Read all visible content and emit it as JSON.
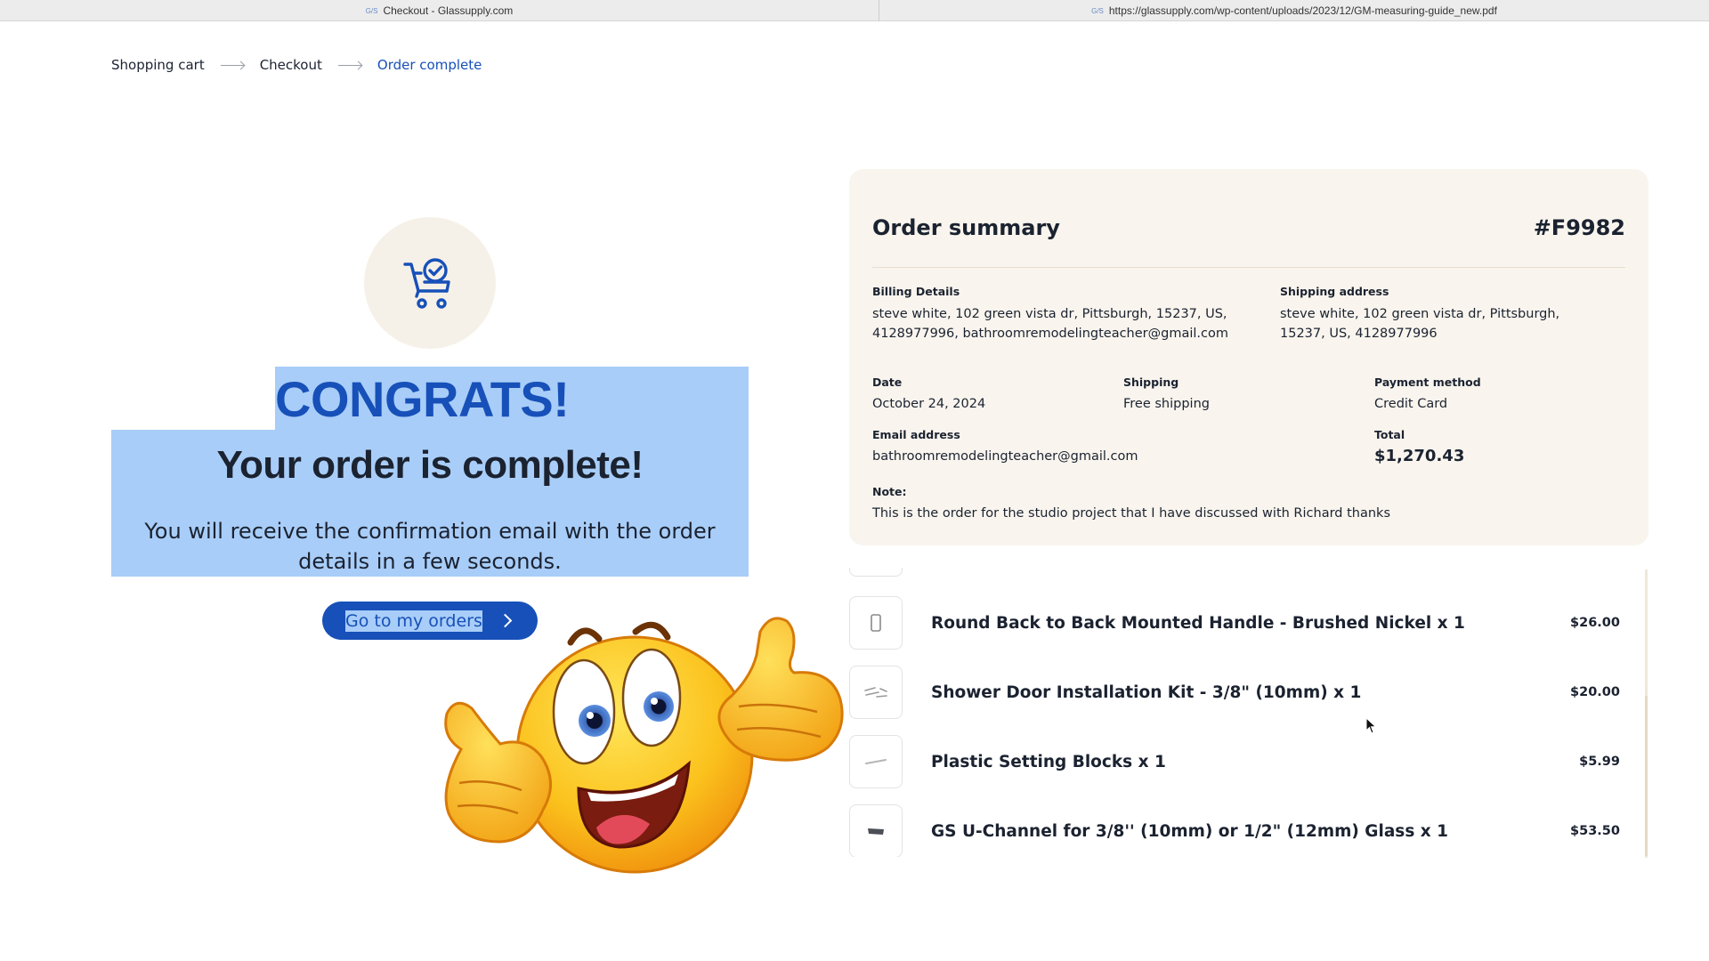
{
  "browser": {
    "tab1_title": "Checkout - Glassupply.com",
    "tab2_title": "https://glassupply.com/wp-content/uploads/2023/12/GM-measuring-guide_new.pdf",
    "favicon_text": "G/S"
  },
  "breadcrumb": {
    "steps": [
      "Shopping cart",
      "Checkout",
      "Order complete"
    ]
  },
  "hero": {
    "congrats": "CONGRATS!",
    "headline": "Your order is complete!",
    "message": "You will receive the confirmation email with the order details in a few seconds.",
    "button_label": "Go to my orders"
  },
  "summary": {
    "title": "Order summary",
    "order_id": "#F9982",
    "billing_label": "Billing Details",
    "billing_value": "steve white, 102 green vista dr, Pittsburgh, 15237, US, 4128977996, bathroomremodelingteacher@gmail.com",
    "shipping_addr_label": "Shipping address",
    "shipping_addr_value": "steve white, 102 green vista dr, Pittsburgh, 15237, US, 4128977996",
    "date_label": "Date",
    "date_value": "October 24, 2024",
    "shipping_label": "Shipping",
    "shipping_value": "Free shipping",
    "payment_label": "Payment method",
    "payment_value": "Credit Card",
    "email_label": "Email address",
    "email_value": "bathroomremodelingteacher@gmail.com",
    "total_label": "Total",
    "total_value": "$1,270.43",
    "note_label": "Note:",
    "note_value": "This is the order for the studio project that I have discussed with Richard thanks"
  },
  "items": [
    {
      "name": "Round Back to Back Mounted Handle - Brushed Nickel x 1",
      "price": "$26.00"
    },
    {
      "name": "Shower Door Installation Kit - 3/8\" (10mm) x 1",
      "price": "$20.00"
    },
    {
      "name": "Plastic Setting Blocks x 1",
      "price": "$5.99"
    },
    {
      "name": "GS U-Channel for 3/8'' (10mm) or 1/2\" (12mm) Glass x 1",
      "price": "$53.50"
    }
  ],
  "colors": {
    "accent": "#1750b8",
    "selection": "#a8cdf8",
    "card_bg": "#f9f5ee",
    "text": "#1b2230"
  },
  "icons": {
    "cart": "cart-check-icon",
    "chevron": "chevron-right-icon",
    "emoji": "thumbs-up-emoji"
  }
}
